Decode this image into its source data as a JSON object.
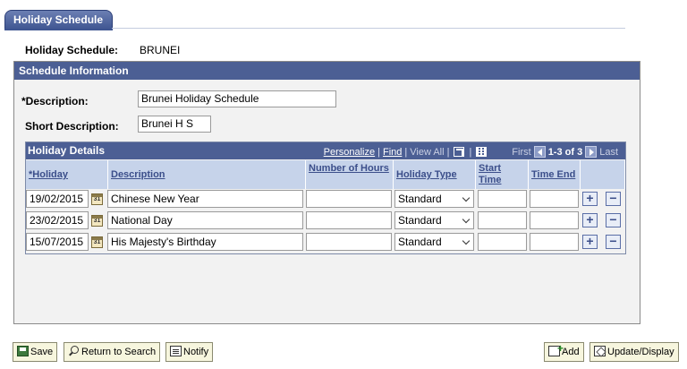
{
  "tab": {
    "label": "Holiday Schedule"
  },
  "header": {
    "schedule_label": "Holiday Schedule:",
    "schedule_value": "BRUNEI"
  },
  "schedule_info": {
    "title": "Schedule Information",
    "description_label": "*Description:",
    "description_value": "Brunei Holiday Schedule",
    "short_description_label": "Short Description:",
    "short_description_value": "Brunei H S"
  },
  "grid": {
    "title": "Holiday Details",
    "nav": {
      "personalize": "Personalize",
      "find": "Find",
      "view_all": "View All",
      "first": "First",
      "count": "1-3 of 3",
      "last": "Last"
    },
    "columns": {
      "holiday": "*Holiday",
      "description": "Description",
      "number_of_hours": "Number of Hours",
      "holiday_type": "Holiday Type",
      "start_time": "Start Time",
      "time_end": "Time End"
    },
    "rows": [
      {
        "holiday": "19/02/2015",
        "description": "Chinese New Year",
        "hours": "",
        "type": "Standard",
        "start": "",
        "end": ""
      },
      {
        "holiday": "23/02/2015",
        "description": "National Day",
        "hours": "",
        "type": "Standard",
        "start": "",
        "end": ""
      },
      {
        "holiday": "15/07/2015",
        "description": "His Majesty's Birthday",
        "hours": "",
        "type": "Standard",
        "start": "",
        "end": ""
      }
    ],
    "calendar_glyph": "31",
    "add_glyph": "+",
    "delete_glyph": "−"
  },
  "toolbar": {
    "save": "Save",
    "return_to_search": "Return to Search",
    "notify": "Notify",
    "add": "Add",
    "update_display": "Update/Display"
  },
  "colors": {
    "header_bar": "#4c5f94",
    "column_header": "#c6d3ea",
    "toolbar_button": "#f7f6de"
  }
}
